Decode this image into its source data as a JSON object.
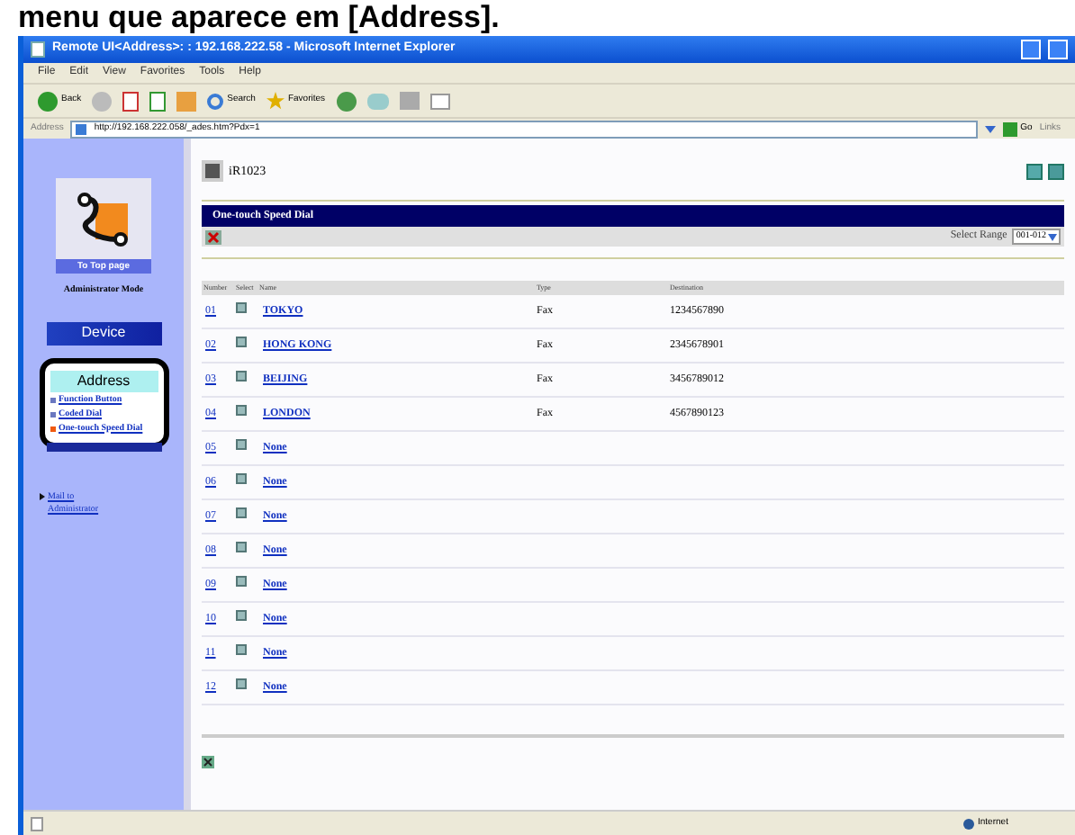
{
  "caption": "menu que aparece em [Address].",
  "window": {
    "title": "Remote UI<Address>: : 192.168.222.58 - Microsoft Internet Explorer"
  },
  "menu": [
    "File",
    "Edit",
    "View",
    "Favorites",
    "Tools",
    "Help"
  ],
  "toolbar": {
    "back": "Back",
    "search": "Search",
    "favorites": "Favorites"
  },
  "address_bar": {
    "label": "Address",
    "url": "http://192.168.222.058/_ades.htm?Pdx=1",
    "go": "Go",
    "links": "Links"
  },
  "sidebar": {
    "top_page": "To Top page",
    "mode": "Administrator Mode",
    "device": "Device",
    "address": "Address",
    "items": [
      {
        "label": "Function Button",
        "selected": false
      },
      {
        "label": "Coded Dial",
        "selected": false
      },
      {
        "label": "One-touch Speed Dial",
        "selected": true
      }
    ],
    "mail": "Mail to Administrator"
  },
  "device_name": "iR1023",
  "section_title": "One-touch Speed Dial",
  "select_range": {
    "label": "Select Range",
    "value": "001-012"
  },
  "table": {
    "columns": [
      "Number",
      "Select",
      "Name",
      "Type",
      "Destination"
    ],
    "rows": [
      {
        "number": "01",
        "name": "TOKYO",
        "type": "Fax",
        "destination": "1234567890"
      },
      {
        "number": "02",
        "name": "HONG KONG",
        "type": "Fax",
        "destination": "2345678901"
      },
      {
        "number": "03",
        "name": "BEIJING",
        "type": "Fax",
        "destination": "3456789012"
      },
      {
        "number": "04",
        "name": "LONDON",
        "type": "Fax",
        "destination": "4567890123"
      },
      {
        "number": "05",
        "name": "None"
      },
      {
        "number": "06",
        "name": "None"
      },
      {
        "number": "07",
        "name": "None"
      },
      {
        "number": "08",
        "name": "None"
      },
      {
        "number": "09",
        "name": "None"
      },
      {
        "number": "10",
        "name": "None"
      },
      {
        "number": "11",
        "name": "None"
      },
      {
        "number": "12",
        "name": "None"
      }
    ]
  },
  "status_bar": {
    "zone": "Internet"
  }
}
